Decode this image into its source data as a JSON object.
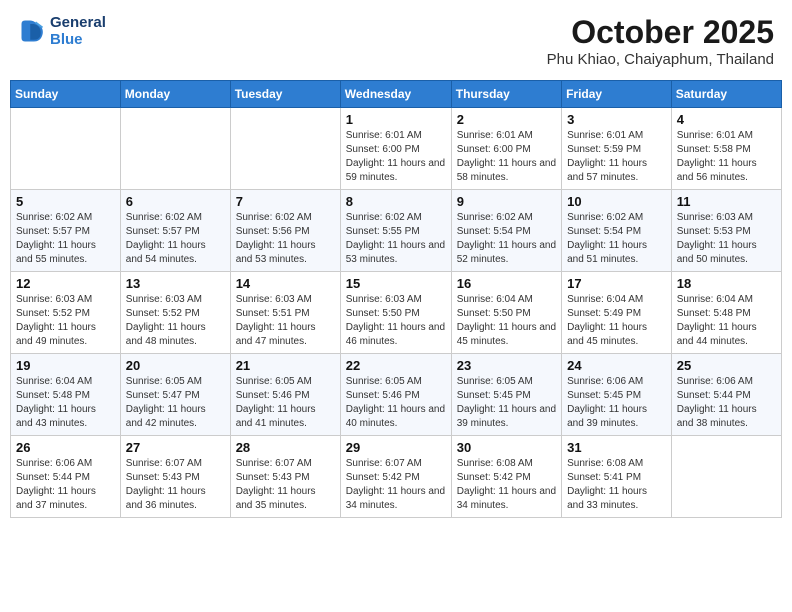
{
  "header": {
    "logo_line1": "General",
    "logo_line2": "Blue",
    "month": "October 2025",
    "location": "Phu Khiao, Chaiyaphum, Thailand"
  },
  "days_of_week": [
    "Sunday",
    "Monday",
    "Tuesday",
    "Wednesday",
    "Thursday",
    "Friday",
    "Saturday"
  ],
  "weeks": [
    [
      {
        "num": "",
        "sunrise": "",
        "sunset": "",
        "daylight": ""
      },
      {
        "num": "",
        "sunrise": "",
        "sunset": "",
        "daylight": ""
      },
      {
        "num": "",
        "sunrise": "",
        "sunset": "",
        "daylight": ""
      },
      {
        "num": "1",
        "sunrise": "Sunrise: 6:01 AM",
        "sunset": "Sunset: 6:00 PM",
        "daylight": "Daylight: 11 hours and 59 minutes."
      },
      {
        "num": "2",
        "sunrise": "Sunrise: 6:01 AM",
        "sunset": "Sunset: 6:00 PM",
        "daylight": "Daylight: 11 hours and 58 minutes."
      },
      {
        "num": "3",
        "sunrise": "Sunrise: 6:01 AM",
        "sunset": "Sunset: 5:59 PM",
        "daylight": "Daylight: 11 hours and 57 minutes."
      },
      {
        "num": "4",
        "sunrise": "Sunrise: 6:01 AM",
        "sunset": "Sunset: 5:58 PM",
        "daylight": "Daylight: 11 hours and 56 minutes."
      }
    ],
    [
      {
        "num": "5",
        "sunrise": "Sunrise: 6:02 AM",
        "sunset": "Sunset: 5:57 PM",
        "daylight": "Daylight: 11 hours and 55 minutes."
      },
      {
        "num": "6",
        "sunrise": "Sunrise: 6:02 AM",
        "sunset": "Sunset: 5:57 PM",
        "daylight": "Daylight: 11 hours and 54 minutes."
      },
      {
        "num": "7",
        "sunrise": "Sunrise: 6:02 AM",
        "sunset": "Sunset: 5:56 PM",
        "daylight": "Daylight: 11 hours and 53 minutes."
      },
      {
        "num": "8",
        "sunrise": "Sunrise: 6:02 AM",
        "sunset": "Sunset: 5:55 PM",
        "daylight": "Daylight: 11 hours and 53 minutes."
      },
      {
        "num": "9",
        "sunrise": "Sunrise: 6:02 AM",
        "sunset": "Sunset: 5:54 PM",
        "daylight": "Daylight: 11 hours and 52 minutes."
      },
      {
        "num": "10",
        "sunrise": "Sunrise: 6:02 AM",
        "sunset": "Sunset: 5:54 PM",
        "daylight": "Daylight: 11 hours and 51 minutes."
      },
      {
        "num": "11",
        "sunrise": "Sunrise: 6:03 AM",
        "sunset": "Sunset: 5:53 PM",
        "daylight": "Daylight: 11 hours and 50 minutes."
      }
    ],
    [
      {
        "num": "12",
        "sunrise": "Sunrise: 6:03 AM",
        "sunset": "Sunset: 5:52 PM",
        "daylight": "Daylight: 11 hours and 49 minutes."
      },
      {
        "num": "13",
        "sunrise": "Sunrise: 6:03 AM",
        "sunset": "Sunset: 5:52 PM",
        "daylight": "Daylight: 11 hours and 48 minutes."
      },
      {
        "num": "14",
        "sunrise": "Sunrise: 6:03 AM",
        "sunset": "Sunset: 5:51 PM",
        "daylight": "Daylight: 11 hours and 47 minutes."
      },
      {
        "num": "15",
        "sunrise": "Sunrise: 6:03 AM",
        "sunset": "Sunset: 5:50 PM",
        "daylight": "Daylight: 11 hours and 46 minutes."
      },
      {
        "num": "16",
        "sunrise": "Sunrise: 6:04 AM",
        "sunset": "Sunset: 5:50 PM",
        "daylight": "Daylight: 11 hours and 45 minutes."
      },
      {
        "num": "17",
        "sunrise": "Sunrise: 6:04 AM",
        "sunset": "Sunset: 5:49 PM",
        "daylight": "Daylight: 11 hours and 45 minutes."
      },
      {
        "num": "18",
        "sunrise": "Sunrise: 6:04 AM",
        "sunset": "Sunset: 5:48 PM",
        "daylight": "Daylight: 11 hours and 44 minutes."
      }
    ],
    [
      {
        "num": "19",
        "sunrise": "Sunrise: 6:04 AM",
        "sunset": "Sunset: 5:48 PM",
        "daylight": "Daylight: 11 hours and 43 minutes."
      },
      {
        "num": "20",
        "sunrise": "Sunrise: 6:05 AM",
        "sunset": "Sunset: 5:47 PM",
        "daylight": "Daylight: 11 hours and 42 minutes."
      },
      {
        "num": "21",
        "sunrise": "Sunrise: 6:05 AM",
        "sunset": "Sunset: 5:46 PM",
        "daylight": "Daylight: 11 hours and 41 minutes."
      },
      {
        "num": "22",
        "sunrise": "Sunrise: 6:05 AM",
        "sunset": "Sunset: 5:46 PM",
        "daylight": "Daylight: 11 hours and 40 minutes."
      },
      {
        "num": "23",
        "sunrise": "Sunrise: 6:05 AM",
        "sunset": "Sunset: 5:45 PM",
        "daylight": "Daylight: 11 hours and 39 minutes."
      },
      {
        "num": "24",
        "sunrise": "Sunrise: 6:06 AM",
        "sunset": "Sunset: 5:45 PM",
        "daylight": "Daylight: 11 hours and 39 minutes."
      },
      {
        "num": "25",
        "sunrise": "Sunrise: 6:06 AM",
        "sunset": "Sunset: 5:44 PM",
        "daylight": "Daylight: 11 hours and 38 minutes."
      }
    ],
    [
      {
        "num": "26",
        "sunrise": "Sunrise: 6:06 AM",
        "sunset": "Sunset: 5:44 PM",
        "daylight": "Daylight: 11 hours and 37 minutes."
      },
      {
        "num": "27",
        "sunrise": "Sunrise: 6:07 AM",
        "sunset": "Sunset: 5:43 PM",
        "daylight": "Daylight: 11 hours and 36 minutes."
      },
      {
        "num": "28",
        "sunrise": "Sunrise: 6:07 AM",
        "sunset": "Sunset: 5:43 PM",
        "daylight": "Daylight: 11 hours and 35 minutes."
      },
      {
        "num": "29",
        "sunrise": "Sunrise: 6:07 AM",
        "sunset": "Sunset: 5:42 PM",
        "daylight": "Daylight: 11 hours and 34 minutes."
      },
      {
        "num": "30",
        "sunrise": "Sunrise: 6:08 AM",
        "sunset": "Sunset: 5:42 PM",
        "daylight": "Daylight: 11 hours and 34 minutes."
      },
      {
        "num": "31",
        "sunrise": "Sunrise: 6:08 AM",
        "sunset": "Sunset: 5:41 PM",
        "daylight": "Daylight: 11 hours and 33 minutes."
      },
      {
        "num": "",
        "sunrise": "",
        "sunset": "",
        "daylight": ""
      }
    ]
  ]
}
